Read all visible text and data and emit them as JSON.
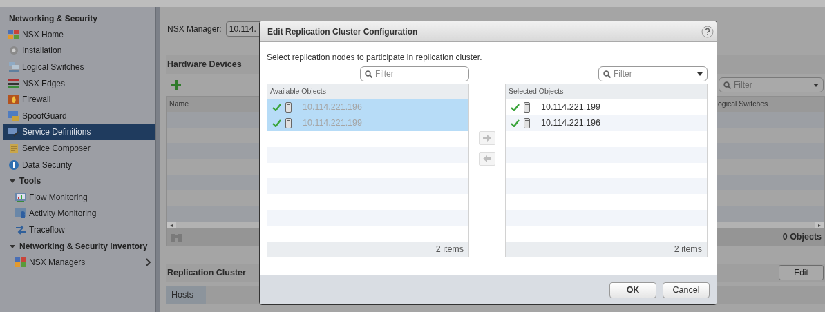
{
  "sidebar": {
    "title": "Networking & Security",
    "items": [
      {
        "kind": "link",
        "label": "NSX Home",
        "selected": false
      },
      {
        "kind": "link",
        "label": "Installation",
        "selected": false
      },
      {
        "kind": "link",
        "label": "Logical Switches",
        "selected": false
      },
      {
        "kind": "link",
        "label": "NSX Edges",
        "selected": false
      },
      {
        "kind": "link",
        "label": "Firewall",
        "selected": false
      },
      {
        "kind": "link",
        "label": "SpoofGuard",
        "selected": false
      },
      {
        "kind": "link",
        "label": "Service Definitions",
        "selected": true
      },
      {
        "kind": "link",
        "label": "Service Composer",
        "selected": false
      },
      {
        "kind": "link",
        "label": "Data Security",
        "selected": false
      },
      {
        "kind": "group",
        "label": "Tools",
        "expanded": true,
        "children": [
          {
            "kind": "link",
            "label": "Flow Monitoring",
            "selected": false
          },
          {
            "kind": "link",
            "label": "Activity Monitoring",
            "selected": false
          },
          {
            "kind": "link",
            "label": "Traceflow",
            "selected": false
          }
        ]
      },
      {
        "kind": "group",
        "label": "Networking & Security Inventory",
        "expanded": true,
        "children": [
          {
            "kind": "link",
            "label": "NSX Managers",
            "selected": false,
            "has_submenu": true
          }
        ]
      }
    ]
  },
  "main": {
    "manager_label": "NSX Manager:",
    "manager_value": "10.114.",
    "hardware": {
      "title": "Hardware Devices",
      "filter_placeholder": "Filter",
      "columns": [
        "Name",
        "ogical Switches"
      ],
      "footer_count": "0 Objects"
    },
    "replication": {
      "title": "Replication Cluster",
      "edit_button": "Edit",
      "tabs": [
        {
          "label": "Hosts",
          "selected": true
        }
      ]
    }
  },
  "dialog": {
    "title": "Edit Replication Cluster Configuration",
    "instruction": "Select replication nodes to participate in replication cluster.",
    "available": {
      "filter_placeholder": "Filter",
      "header": "Available Objects",
      "rows": [
        {
          "label": "10.114.221.196",
          "selected": true,
          "disabled": true
        },
        {
          "label": "10.114.221.199",
          "selected": true,
          "disabled": true
        }
      ],
      "footer": "2 items"
    },
    "chosen": {
      "filter_placeholder": "Filter",
      "header": "Selected Objects",
      "rows": [
        {
          "label": "10.114.221.199",
          "selected": false,
          "disabled": false
        },
        {
          "label": "10.114.221.196",
          "selected": false,
          "disabled": false
        }
      ],
      "footer": "2 items"
    },
    "buttons": [
      "OK",
      "Cancel"
    ]
  }
}
